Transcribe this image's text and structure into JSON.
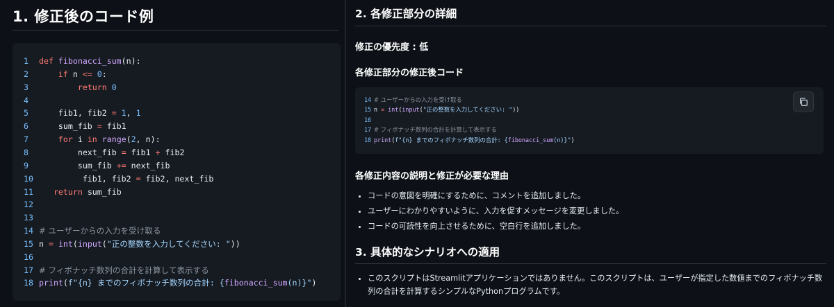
{
  "left": {
    "title": "1. 修正後のコード例",
    "code": [
      {
        "n": "1",
        "parts": [
          [
            "kw",
            "def "
          ],
          [
            "fn",
            "fibonacci_sum"
          ],
          [
            "txt",
            "(n):"
          ]
        ]
      },
      {
        "n": "2",
        "parts": [
          [
            "txt",
            "    "
          ],
          [
            "kw",
            "if"
          ],
          [
            "txt",
            " n "
          ],
          [
            "op",
            "<="
          ],
          [
            "txt",
            " "
          ],
          [
            "num",
            "0"
          ],
          [
            "txt",
            ":"
          ]
        ]
      },
      {
        "n": "3",
        "parts": [
          [
            "txt",
            "        "
          ],
          [
            "kw",
            "return"
          ],
          [
            "txt",
            " "
          ],
          [
            "num",
            "0"
          ]
        ]
      },
      {
        "n": "4",
        "parts": []
      },
      {
        "n": "5",
        "parts": [
          [
            "txt",
            "    fib1, fib2 "
          ],
          [
            "op",
            "="
          ],
          [
            "txt",
            " "
          ],
          [
            "num",
            "1"
          ],
          [
            "txt",
            ", "
          ],
          [
            "num",
            "1"
          ]
        ]
      },
      {
        "n": "6",
        "parts": [
          [
            "txt",
            "    sum_fib "
          ],
          [
            "op",
            "="
          ],
          [
            "txt",
            " fib1"
          ]
        ]
      },
      {
        "n": "7",
        "parts": [
          [
            "txt",
            "    "
          ],
          [
            "kw",
            "for"
          ],
          [
            "txt",
            " i "
          ],
          [
            "kw",
            "in"
          ],
          [
            "txt",
            " "
          ],
          [
            "fn",
            "range"
          ],
          [
            "txt",
            "("
          ],
          [
            "num",
            "2"
          ],
          [
            "txt",
            ", n):"
          ]
        ]
      },
      {
        "n": "8",
        "parts": [
          [
            "txt",
            "        next_fib "
          ],
          [
            "op",
            "="
          ],
          [
            "txt",
            " fib1 "
          ],
          [
            "op",
            "+"
          ],
          [
            "txt",
            " fib2"
          ]
        ]
      },
      {
        "n": "9",
        "parts": [
          [
            "txt",
            "        sum_fib "
          ],
          [
            "op",
            "+="
          ],
          [
            "txt",
            " next_fib"
          ]
        ]
      },
      {
        "n": "10",
        "parts": [
          [
            "txt",
            "         fib1, fib2 "
          ],
          [
            "op",
            "="
          ],
          [
            "txt",
            " fib2, next_fib"
          ]
        ]
      },
      {
        "n": "11",
        "parts": [
          [
            "txt",
            "   "
          ],
          [
            "kw",
            "return"
          ],
          [
            "txt",
            " sum_fib"
          ]
        ]
      },
      {
        "n": "12",
        "parts": []
      },
      {
        "n": "13",
        "parts": []
      },
      {
        "n": "14",
        "parts": [
          [
            "cm",
            "# ユーザーからの入力を受け取る"
          ]
        ]
      },
      {
        "n": "15",
        "parts": [
          [
            "txt",
            "n "
          ],
          [
            "op",
            "="
          ],
          [
            "txt",
            " "
          ],
          [
            "fn",
            "int"
          ],
          [
            "txt",
            "("
          ],
          [
            "fn",
            "input"
          ],
          [
            "txt",
            "("
          ],
          [
            "str",
            "\"正の整数を入力してください: \""
          ],
          [
            "txt",
            "))"
          ]
        ]
      },
      {
        "n": "16",
        "parts": []
      },
      {
        "n": "17",
        "parts": [
          [
            "cm",
            "# フィボナッチ数列の合計を計算して表示する"
          ]
        ]
      },
      {
        "n": "18",
        "parts": [
          [
            "fn",
            "print"
          ],
          [
            "txt",
            "("
          ],
          [
            "str",
            "f\"{n} までのフィボナッチ数列の合計: {"
          ],
          [
            "fn",
            "fibonacci_sum"
          ],
          [
            "str",
            "(n)}\""
          ],
          [
            "txt",
            ")"
          ]
        ]
      }
    ]
  },
  "right": {
    "section2_title": "2. 各修正部分の詳細",
    "priority": "修正の優先度 : 低",
    "code_heading": "各修正部分の修正後コード",
    "snippet": [
      {
        "n": "14",
        "parts": [
          [
            "cm",
            "# ユーザーからの入力を受け取る"
          ]
        ]
      },
      {
        "n": "15",
        "parts": [
          [
            "txt",
            "n "
          ],
          [
            "op",
            "="
          ],
          [
            "txt",
            " "
          ],
          [
            "fn",
            "int"
          ],
          [
            "txt",
            "("
          ],
          [
            "fn",
            "input"
          ],
          [
            "txt",
            "("
          ],
          [
            "str",
            "\"正の整数を入力してください: \""
          ],
          [
            "txt",
            "))"
          ]
        ]
      },
      {
        "n": "16",
        "parts": []
      },
      {
        "n": "17",
        "parts": [
          [
            "cm",
            "# フィボナッチ数列の合計を計算して表示する"
          ]
        ]
      },
      {
        "n": "18",
        "parts": [
          [
            "fn",
            "print"
          ],
          [
            "txt",
            "("
          ],
          [
            "str",
            "f\"{n} までのフィボナッチ数列の合計: {"
          ],
          [
            "fn",
            "fibonacci_sum"
          ],
          [
            "str",
            "(n)}\""
          ],
          [
            "txt",
            ")"
          ]
        ]
      }
    ],
    "copy_icon": "copy-icon",
    "reasons_heading": "各修正内容の説明と修正が必要な理由",
    "reasons": [
      "コードの意図を明確にするために、コメントを追加しました。",
      "ユーザーにわかりやすいように、入力を促すメッセージを変更しました。",
      "コードの可読性を向上させるために、空白行を追加しました。"
    ],
    "section3_title": "3. 具体的なシナリオへの適用",
    "scenario": "このスクリプトはStreamlitアプリケーションではありません。このスクリプトは、ユーザーが指定した数値までのフィボナッチ数列の合計を計算するシンプルなPythonプログラムです。"
  },
  "colors": {
    "background": "#0d1117",
    "code_background": "#161b22",
    "keyword": "#ff7b72",
    "function": "#d2a8ff",
    "number": "#79c0ff",
    "string": "#a5d6ff",
    "comment": "#8b949e"
  }
}
